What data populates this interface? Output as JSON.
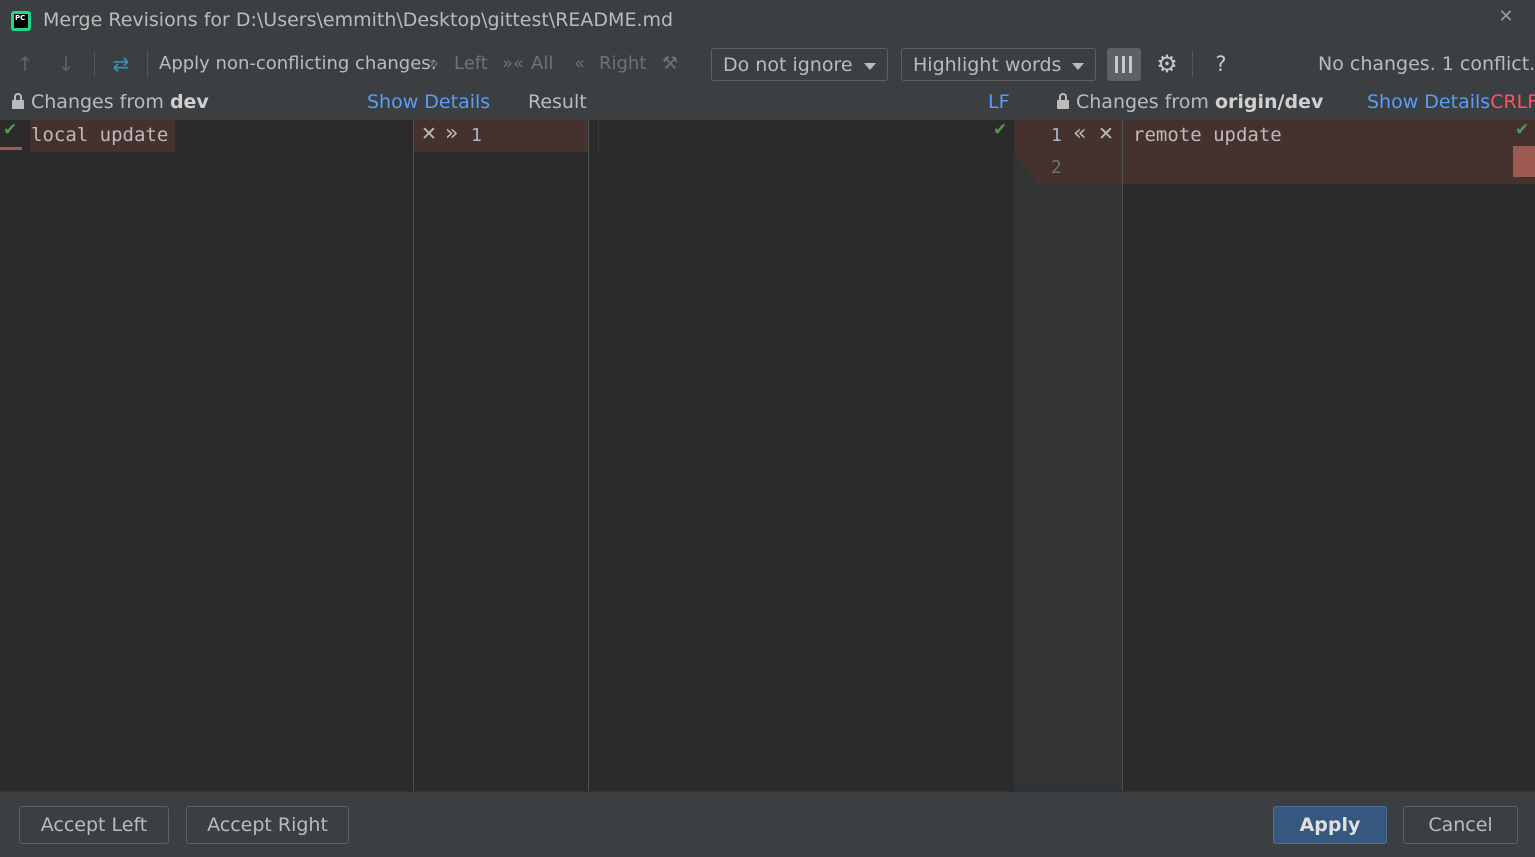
{
  "window": {
    "title": "Merge Revisions for D:\\Users\\emmith\\Desktop\\gittest\\README.md",
    "close_glyph": "✕"
  },
  "toolbar": {
    "prev_icon": "↑",
    "next_icon": "↓",
    "resolve_icon": "⇄",
    "apply_label": "Apply non-conflicting changes:",
    "left_icon": "»",
    "left_label": "Left",
    "all_icon": "»«",
    "all_label": "All",
    "right_icon": "«",
    "right_label": "Right",
    "magic_icon": "⚒",
    "ignore_select": "Do not ignore",
    "highlight_select": "Highlight words",
    "gear_glyph": "⚙",
    "help_glyph": "?",
    "status": "No changes. 1 conflict."
  },
  "header": {
    "left_prefix": "Changes from ",
    "left_branch": "dev",
    "show_details": "Show Details",
    "result_label": "Result",
    "lf_label": "LF",
    "right_prefix": "Changes from ",
    "right_branch": "origin/dev",
    "show_details_right": "Show Details",
    "crlf_label": "CRLF"
  },
  "editor": {
    "left_line_1": "local update",
    "left_gutter_reject": "✕",
    "left_gutter_accept": "»",
    "result_line_number": "1",
    "right_line_number_1": "1",
    "right_line_number_2": "2",
    "right_gutter_accept": "«",
    "right_gutter_reject": "✕",
    "right_line_1": "remote update",
    "check_glyph": "✔"
  },
  "footer": {
    "accept_left": "Accept Left",
    "accept_right": "Accept Right",
    "apply": "Apply",
    "cancel": "Cancel"
  },
  "colors": {
    "conflict_bg": "#45322f",
    "link": "#589df6",
    "crlf": "#ff5261",
    "check": "#499c54",
    "primary_button": "#365880"
  }
}
